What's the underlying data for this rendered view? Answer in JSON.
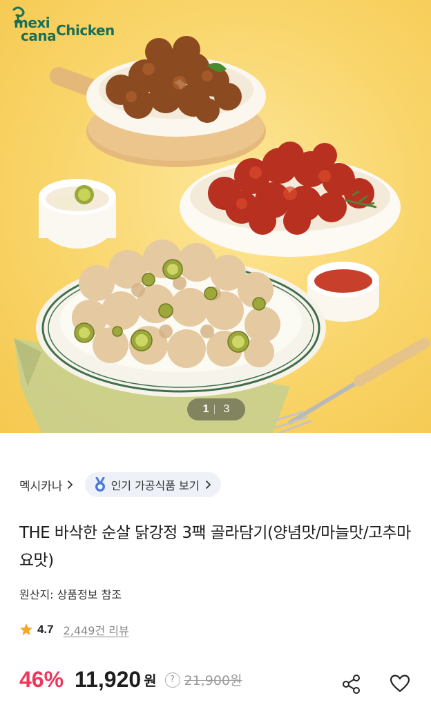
{
  "hero": {
    "brand_top": "mexi",
    "brand_bottom": "cana",
    "brand_right": "Chicken",
    "pager_current": "1",
    "pager_total": "3"
  },
  "seller": {
    "name": "멕시카나"
  },
  "chip": {
    "label": "인기 가공식품 보기"
  },
  "product": {
    "title": "THE 바삭한 순살 닭강정 3팩 골라담기(양념맛/마늘맛/고추마요맛)",
    "origin": "원산지: 상품정보 참조"
  },
  "rating": {
    "score": "4.7",
    "reviews": "2,449건 리뷰"
  },
  "price": {
    "discount": "46%",
    "sale": "11,920",
    "currency": "원",
    "help": "?",
    "original": "21,900원"
  },
  "icons": [
    "star-icon",
    "medal-icon",
    "chevron-right-icon",
    "share-icon",
    "heart-icon",
    "help-icon"
  ],
  "colors": {
    "brand_green": "#1a6f56",
    "discount_red": "#f0365b",
    "star_orange": "#f5a623",
    "chip_bg": "#eef1f8"
  }
}
